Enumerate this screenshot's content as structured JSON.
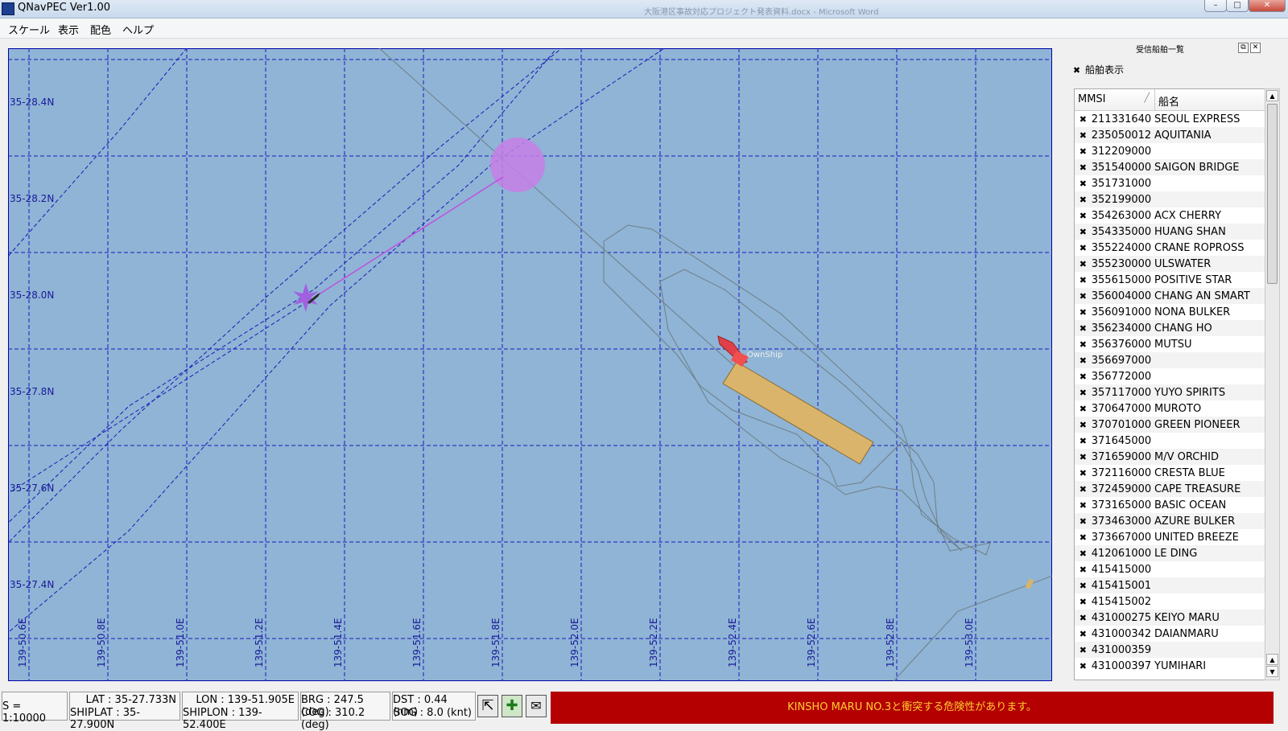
{
  "window": {
    "title": "QNavPEC Ver1.00",
    "background_title": "大阪港区事故対応プロジェクト発表資料.docx - Microsoft Word",
    "controls": [
      "–",
      "□",
      "✕"
    ]
  },
  "menu": [
    "スケール",
    "表示",
    "配色",
    "ヘルプ"
  ],
  "chart": {
    "lat_labels": [
      "35-28.4N",
      "35-28.2N",
      "35-28.0N",
      "35-27.8N",
      "35-27.6N",
      "35-27.4N"
    ],
    "lon_labels": [
      "139-50.6E",
      "139-50.8E",
      "139-51.0E",
      "139-51.2E",
      "139-51.4E",
      "139-51.6E",
      "139-51.8E",
      "139-52.0E",
      "139-52.2E",
      "139-52.4E",
      "139-52.6E",
      "139-52.8E",
      "139-53.0E"
    ],
    "ownship_label": "OwnShip",
    "colors": {
      "sea": "#8fb4d5",
      "grid": "#1a1ac0",
      "target_zone": "#c77fe6",
      "ownship": "#e0404a",
      "ownship_course": "#d9b46a"
    }
  },
  "panel": {
    "title": "受信船舶一覧",
    "show_ships_label": "船舶表示",
    "show_ships_checked": true,
    "columns": {
      "mmsi": "MMSI",
      "name": "船名"
    },
    "ships": [
      {
        "mmsi": "211331640",
        "name": "SEOUL EXPRESS"
      },
      {
        "mmsi": "235050012",
        "name": "AQUITANIA"
      },
      {
        "mmsi": "312209000",
        "name": ""
      },
      {
        "mmsi": "351540000",
        "name": "SAIGON BRIDGE"
      },
      {
        "mmsi": "351731000",
        "name": ""
      },
      {
        "mmsi": "352199000",
        "name": ""
      },
      {
        "mmsi": "354263000",
        "name": "ACX CHERRY"
      },
      {
        "mmsi": "354335000",
        "name": "HUANG SHAN"
      },
      {
        "mmsi": "355224000",
        "name": "CRANE ROPROSS"
      },
      {
        "mmsi": "355230000",
        "name": "ULSWATER"
      },
      {
        "mmsi": "355615000",
        "name": "POSITIVE STAR"
      },
      {
        "mmsi": "356004000",
        "name": "CHANG AN SMART"
      },
      {
        "mmsi": "356091000",
        "name": "NONA BULKER"
      },
      {
        "mmsi": "356234000",
        "name": "CHANG HO"
      },
      {
        "mmsi": "356376000",
        "name": "MUTSU"
      },
      {
        "mmsi": "356697000",
        "name": ""
      },
      {
        "mmsi": "356772000",
        "name": ""
      },
      {
        "mmsi": "357117000",
        "name": "YUYO SPIRITS"
      },
      {
        "mmsi": "370647000",
        "name": "MUROTO"
      },
      {
        "mmsi": "370701000",
        "name": "GREEN PIONEER"
      },
      {
        "mmsi": "371645000",
        "name": ""
      },
      {
        "mmsi": "371659000",
        "name": "M/V ORCHID"
      },
      {
        "mmsi": "372116000",
        "name": "CRESTA BLUE"
      },
      {
        "mmsi": "372459000",
        "name": "CAPE TREASURE"
      },
      {
        "mmsi": "373165000",
        "name": "BASIC OCEAN"
      },
      {
        "mmsi": "373463000",
        "name": "AZURE BULKER"
      },
      {
        "mmsi": "373667000",
        "name": "UNITED BREEZE"
      },
      {
        "mmsi": "412061000",
        "name": "LE DING"
      },
      {
        "mmsi": "415415000",
        "name": ""
      },
      {
        "mmsi": "415415001",
        "name": ""
      },
      {
        "mmsi": "415415002",
        "name": ""
      },
      {
        "mmsi": "431000275",
        "name": "KEIYO MARU"
      },
      {
        "mmsi": "431000342",
        "name": "DAIANMARU"
      },
      {
        "mmsi": "431000359",
        "name": ""
      },
      {
        "mmsi": "431000397",
        "name": "YUMIHARI"
      }
    ]
  },
  "status": {
    "scale": "S = 1:10000",
    "lat": "LAT : 35-27.733N",
    "shiplat": "SHIPLAT : 35-27.900N",
    "lon": "LON : 139-51.905E",
    "shiplon": "SHIPLON : 139-52.400E",
    "brg": "BRG : 247.5 (deg)",
    "cog": "COG : 310.2 (deg)",
    "dst": "DST : 0.44 (nm)",
    "sog": "SOG : 8.0 (knt)",
    "alert": "KINSHO MARU NO.3と衝突する危険性があります。",
    "alert_color": "#b40000",
    "alert_text_color": "#ffcc33"
  }
}
